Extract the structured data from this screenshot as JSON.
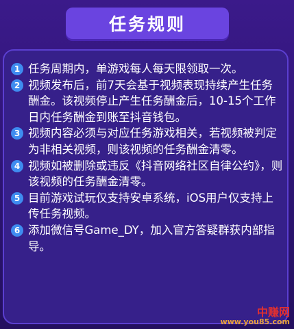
{
  "title": "任务规则",
  "rules": [
    {
      "num": "1",
      "text": "任务周期内，单游戏每人每天限领取一次。"
    },
    {
      "num": "2",
      "text": "视频发布后，前7天会基于视频表现持续产生任务酬金。该视频停止产生任务酬金后，10-15个工作日内任务酬金到账至抖音钱包。"
    },
    {
      "num": "3",
      "text": "视频内容必须与对应任务游戏相关，若视频被判定为非相关视频，则该视频的任务酬金清零。"
    },
    {
      "num": "4",
      "text": "视频如被删除或违反《抖音网络社区自律公约》，则该视频的任务酬金清零。"
    },
    {
      "num": "5",
      "text": "目前游戏试玩仅支持安卓系统，iOS用户仅支持上传任务视频。"
    },
    {
      "num": "6",
      "text": "添加微信号Game_DY，加入官方答疑群获内部指导。"
    }
  ],
  "watermark": {
    "name": "中赚网",
    "url": "www.you85.com"
  },
  "colors": {
    "background": "#2c1473",
    "title_pill": "#6a44e0",
    "panel": "#36208a",
    "number_badge": "#3f8cf0"
  }
}
